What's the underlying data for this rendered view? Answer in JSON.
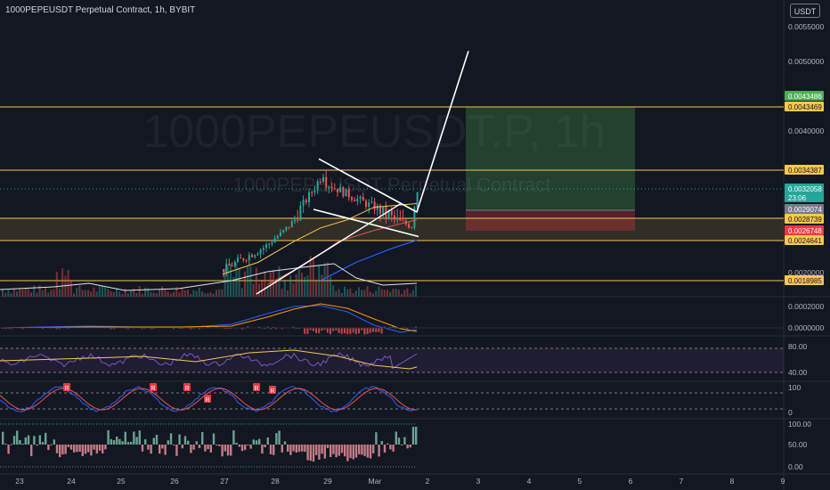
{
  "header": {
    "title": "1000PEPEUSDT Perpetual Contract, 1h, BYBIT",
    "currency": "USDT"
  },
  "watermark": {
    "symbol": "1000PEPEUSDT.P, 1h",
    "description": "1000PEPEUSDT Perpetual Contract"
  },
  "chart_data": {
    "type": "candlestick",
    "main_pane": {
      "y_ticks": [
        "0.0055000",
        "0.0050000",
        "0.0040000",
        "0.0020000"
      ],
      "price_labels": [
        {
          "text": "0.0043486",
          "bg": "#4caf50",
          "fg": "#ffffff",
          "value": 0.0043486
        },
        {
          "text": "0.0043469",
          "bg": "#f9c74f",
          "fg": "#131722",
          "value": 0.0043469
        },
        {
          "text": "0.0034387",
          "bg": "#f9c74f",
          "fg": "#131722",
          "value": 0.0034387
        },
        {
          "text": "0.0032058",
          "bg": "#26a69a",
          "fg": "#ffffff",
          "value": 0.0032058
        },
        {
          "text": "23:06",
          "bg": "#26a69a",
          "fg": "#ffffff",
          "value": 0.00316
        },
        {
          "text": "0.0029074",
          "bg": "#787b86",
          "fg": "#ffffff",
          "value": 0.0029074
        },
        {
          "text": "0.0028739",
          "bg": "#f9c74f",
          "fg": "#131722",
          "value": 0.0028739
        },
        {
          "text": "0.0026748",
          "bg": "#f23645",
          "fg": "#ffffff",
          "value": 0.0026748
        },
        {
          "text": "0.0024641",
          "bg": "#f9c74f",
          "fg": "#131722",
          "value": 0.0024641
        },
        {
          "text": "0.0018985",
          "bg": "#f9c74f",
          "fg": "#131722",
          "value": 0.0018985
        }
      ],
      "horizontal_levels": [
        0.0043469,
        0.0034387,
        0.0028739,
        0.0024641,
        0.0018985
      ],
      "position_tool": {
        "entry": 0.0029074,
        "take_profit": 0.0043486,
        "stop_loss": 0.0026748
      }
    },
    "macd_pane": {
      "y_ticks": [
        "0.0002000",
        "0.0000000"
      ]
    },
    "rsi_pane": {
      "y_ticks": [
        "80.00",
        "40.00"
      ]
    },
    "stoch_pane": {
      "y_ticks": [
        "100",
        "0"
      ],
      "signal_label": "R"
    },
    "osc_pane": {
      "y_ticks": [
        "100.00",
        "50.00",
        "0.00"
      ]
    },
    "x_ticks": [
      "23",
      "24",
      "25",
      "26",
      "27",
      "28",
      "29",
      "Mar",
      "2",
      "3",
      "4",
      "5",
      "6",
      "7",
      "8",
      "9"
    ]
  }
}
